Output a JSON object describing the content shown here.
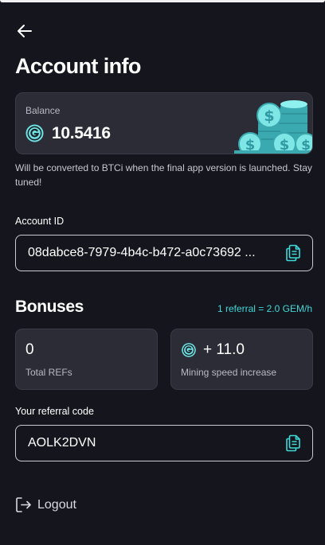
{
  "header": {
    "back_icon": "arrow-left-icon",
    "title": "Account info"
  },
  "balance": {
    "label": "Balance",
    "value": "10.5416",
    "currency_icon": "gem-coin-icon",
    "illustration": "coin-stacks-illustration",
    "note": "Will be converted to BTCi when the final app version is launched. Stay tuned!"
  },
  "account": {
    "label": "Account ID",
    "value": "08dabce8-7979-4b4c-b472-a0c73692 ...",
    "copy_icon": "copy-icon"
  },
  "bonuses": {
    "title": "Bonuses",
    "rate": "1 referral = 2.0 GEM/h",
    "cards": [
      {
        "value": "0",
        "label": "Total REFs"
      },
      {
        "value": "+ 11.0",
        "label": "Mining speed increase",
        "icon": "gem-coin-icon"
      }
    ]
  },
  "referral": {
    "label": "Your referral code",
    "value": "AOLK2DVN",
    "copy_icon": "copy-icon"
  },
  "logout": {
    "label": "Logout",
    "icon": "logout-icon"
  },
  "colors": {
    "background": "#15161d",
    "card": "#2b2c35",
    "accent": "#3fd8d8",
    "border": "#c9cad3"
  }
}
